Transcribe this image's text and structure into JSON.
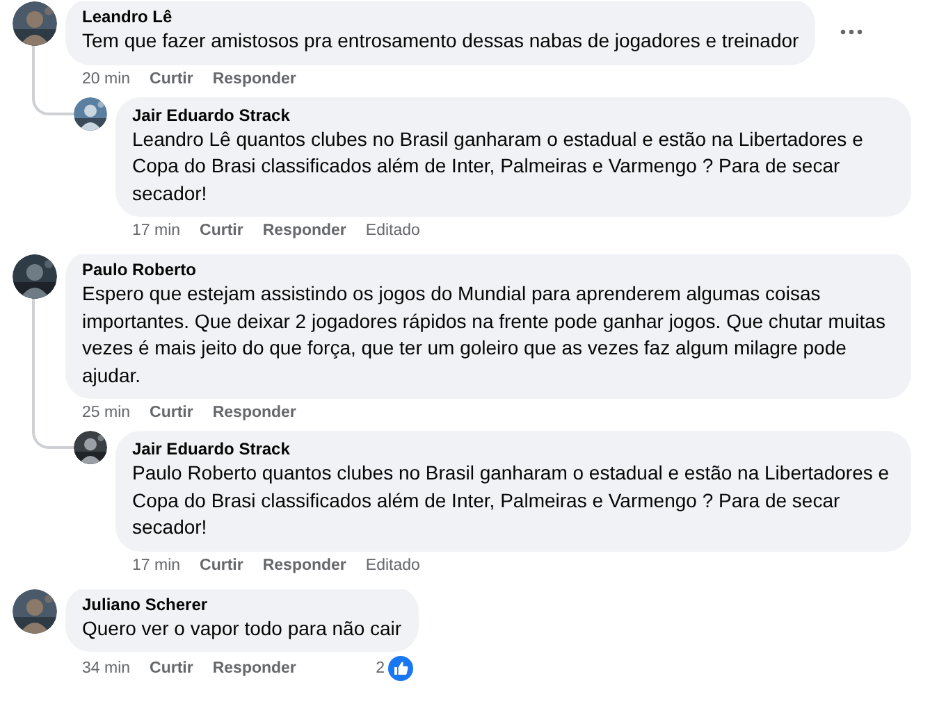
{
  "comments": [
    {
      "author": "Leandro Lê",
      "text": "Tem que fazer amistosos pra entrosamento dessas nabas de jogadores e treinador",
      "time": "20 min",
      "actions": [
        "Curtir",
        "Responder"
      ],
      "show_menu": true,
      "replies": [
        {
          "author": "Jair Eduardo Strack",
          "text": "Leandro Lê quantos clubes no Brasil ganharam o estadual e estão na Libertadores e Copa do Brasi classificados além de Inter, Palmeiras e Varmengo ? Para de secar secador!",
          "time": "17 min",
          "actions": [
            "Curtir",
            "Responder"
          ],
          "edited": "Editado"
        }
      ]
    },
    {
      "author": "Paulo Roberto",
      "text": "Espero que estejam assistindo os jogos do Mundial para aprenderem algumas coisas importantes. Que deixar 2 jogadores rápidos na frente pode ganhar jogos. Que chutar muitas vezes é mais jeito do que força, que ter um goleiro que as vezes faz algum milagre pode ajudar.",
      "time": "25 min",
      "actions": [
        "Curtir",
        "Responder"
      ],
      "show_menu": false,
      "replies": [
        {
          "author": "Jair Eduardo Strack",
          "text": "Paulo Roberto quantos clubes no Brasil ganharam o estadual e estão na Libertadores e Copa do Brasi classificados além de Inter, Palmeiras e Varmengo ? Para de secar secador!",
          "time": "17 min",
          "actions": [
            "Curtir",
            "Responder"
          ],
          "edited": "Editado"
        }
      ]
    },
    {
      "author": "Juliano Scherer",
      "text": "Quero ver o vapor todo para não cair",
      "time": "34 min",
      "actions": [
        "Curtir",
        "Responder"
      ],
      "show_menu": false,
      "reaction_count": "2"
    }
  ]
}
